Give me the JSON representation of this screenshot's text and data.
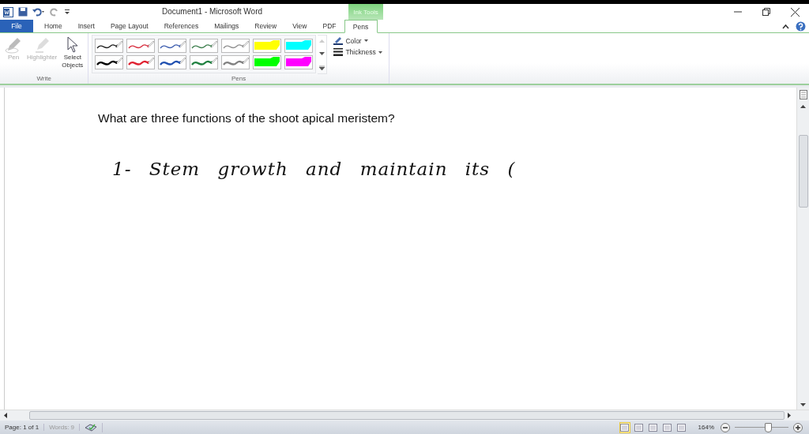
{
  "window": {
    "title": "Document1  -  Microsoft Word",
    "context_tab_group": "Ink Tools"
  },
  "tabs": [
    {
      "label": "File",
      "kind": "file",
      "selected": false
    },
    {
      "label": "Home",
      "kind": "tab",
      "selected": false
    },
    {
      "label": "Insert",
      "kind": "tab",
      "selected": false
    },
    {
      "label": "Page Layout",
      "kind": "tab",
      "selected": false
    },
    {
      "label": "References",
      "kind": "tab",
      "selected": false
    },
    {
      "label": "Mailings",
      "kind": "tab",
      "selected": false
    },
    {
      "label": "Review",
      "kind": "tab",
      "selected": false
    },
    {
      "label": "View",
      "kind": "tab",
      "selected": false
    },
    {
      "label": "PDF",
      "kind": "tab",
      "selected": false
    },
    {
      "label": "Pens",
      "kind": "tab",
      "selected": true
    }
  ],
  "ribbon": {
    "write_group": {
      "label": "Write",
      "tools": [
        {
          "label": "Pen",
          "kind": "pen",
          "disabled": true
        },
        {
          "label": "Highlighter",
          "kind": "highlighter",
          "disabled": true
        },
        {
          "label": "Select\nObjects",
          "kind": "select",
          "disabled": false
        }
      ]
    },
    "pens_group": {
      "label": "Pens",
      "pens": [
        {
          "kind": "pen",
          "color": "#202020",
          "thick": false
        },
        {
          "kind": "pen",
          "color": "#d83040",
          "thick": false
        },
        {
          "kind": "pen",
          "color": "#4060b0",
          "thick": false
        },
        {
          "kind": "pen",
          "color": "#408050",
          "thick": false
        },
        {
          "kind": "pen",
          "color": "#909090",
          "thick": false
        },
        {
          "kind": "highlighter",
          "color": "#ffff00"
        },
        {
          "kind": "highlighter",
          "color": "#00ffff"
        },
        {
          "kind": "pen",
          "color": "#000000",
          "thick": true
        },
        {
          "kind": "pen",
          "color": "#e02030",
          "thick": true
        },
        {
          "kind": "pen",
          "color": "#2050b0",
          "thick": true
        },
        {
          "kind": "pen",
          "color": "#208040",
          "thick": true
        },
        {
          "kind": "pen",
          "color": "#808080",
          "thick": true
        },
        {
          "kind": "highlighter",
          "color": "#00ff00"
        },
        {
          "kind": "highlighter",
          "color": "#ff00ff"
        }
      ]
    },
    "format": [
      {
        "label": "Color",
        "kind": "color"
      },
      {
        "label": "Thickness",
        "kind": "thickness"
      }
    ]
  },
  "document": {
    "question": "What are three functions of the shoot apical meristem?",
    "ink_text": "1- Stem growth and maintain its ("
  },
  "status_bar": {
    "page": "Page: 1 of 1",
    "words": "Words: 9",
    "views": [
      {
        "selected": true
      },
      {
        "selected": false
      },
      {
        "selected": false
      },
      {
        "selected": false
      },
      {
        "selected": false
      }
    ],
    "zoom": "164%",
    "zoom_slider": {
      "level": 0.62
    }
  }
}
